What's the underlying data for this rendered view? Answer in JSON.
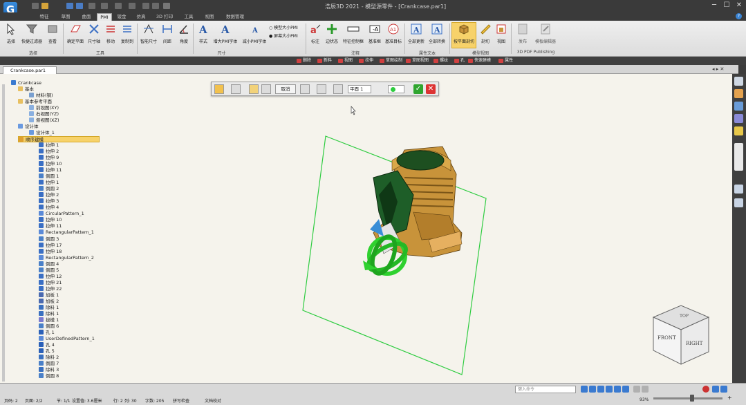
{
  "window": {
    "title": "浩辰3D 2021 - 模型源零件 - [Crankcase.par1]",
    "logo": "G",
    "controls": [
      "─",
      "☐",
      "✕"
    ]
  },
  "tabs": [
    {
      "label": "特征",
      "active": false
    },
    {
      "label": "草图",
      "active": false
    },
    {
      "label": "曲面",
      "active": false
    },
    {
      "label": "PMI",
      "active": true
    },
    {
      "label": "钣金",
      "active": false
    },
    {
      "label": "仿真",
      "active": false
    },
    {
      "label": "3D 打印",
      "active": false
    },
    {
      "label": "工具",
      "active": false
    },
    {
      "label": "视图",
      "active": false
    },
    {
      "label": "数据管理",
      "active": false
    }
  ],
  "ribbon": {
    "buttons": [
      {
        "label": "选择",
        "icon": "cursor-icon"
      },
      {
        "label": "快捷过滤器",
        "icon": "filter-icon"
      },
      {
        "label": "查看",
        "icon": "view-icon"
      },
      {
        "label": "确定平面",
        "icon": "plane-icon"
      },
      {
        "label": "尺寸轴",
        "icon": "axis-icon"
      },
      {
        "label": "移动",
        "icon": "move-icon"
      },
      {
        "label": "复制到",
        "icon": "copy-icon"
      },
      {
        "label": "智能尺寸",
        "icon": "smart-dimension-icon"
      },
      {
        "label": "间距",
        "icon": "distance-icon"
      },
      {
        "label": "角度",
        "icon": "angle-icon"
      },
      {
        "label": "样式",
        "icon": "style-icon"
      },
      {
        "label": "增大PMI字体",
        "icon": "font-increase-icon"
      },
      {
        "label": "减小PMI字体",
        "icon": "font-decrease-icon"
      },
      {
        "label": "标注",
        "icon": "annotation-icon"
      },
      {
        "label": "边状态",
        "icon": "edge-state-icon"
      },
      {
        "label": "特征控制框",
        "icon": "feature-control-frame-icon"
      },
      {
        "label": "基准框",
        "icon": "datum-frame-icon"
      },
      {
        "label": "基准目标",
        "icon": "datum-target-icon"
      },
      {
        "label": "全部更新",
        "icon": "update-all-icon"
      },
      {
        "label": "全部转换",
        "icon": "convert-all-icon"
      },
      {
        "label": "按平面剖切",
        "icon": "section-plane-icon"
      },
      {
        "label": "剖切",
        "icon": "section-icon"
      },
      {
        "label": "视图",
        "icon": "model-view-icon"
      },
      {
        "label": "发布",
        "icon": "publish-icon"
      },
      {
        "label": "模板编辑器",
        "icon": "template-editor-icon"
      }
    ],
    "toggles": [
      {
        "label": "模型大小PMI"
      },
      {
        "label": "屏幕大小PMI"
      }
    ],
    "groups": [
      "选择",
      "工具",
      "尺寸",
      "注释",
      "属性文本",
      "模型视图",
      "3D PDF Publishing"
    ]
  },
  "command_bar": [
    {
      "label": "删除"
    },
    {
      "label": "新料"
    },
    {
      "label": "视图"
    },
    {
      "label": "拉伸"
    },
    {
      "label": "草图绘制"
    },
    {
      "label": "草图视图"
    },
    {
      "label": "螺纹"
    },
    {
      "label": "孔"
    },
    {
      "label": "快速建模"
    },
    {
      "label": "属性"
    }
  ],
  "document_tab": {
    "label": "Crankcase.par1"
  },
  "floating_toolbar": {
    "cancel_label": "取消",
    "plane_value": "平面 1"
  },
  "tree": [
    {
      "label": "Crankcase",
      "indent": 0,
      "icon": "part-icon"
    },
    {
      "label": "基本",
      "indent": 1,
      "icon": "folder-icon"
    },
    {
      "label": "材料(钢)",
      "indent": 2,
      "icon": "material-icon"
    },
    {
      "label": "基本参考平面",
      "indent": 1,
      "icon": "folder-icon"
    },
    {
      "label": "前视图(XY)",
      "indent": 2,
      "icon": "plane-icon"
    },
    {
      "label": "右视图(YZ)",
      "indent": 2,
      "icon": "plane-icon"
    },
    {
      "label": "俯视图(XZ)",
      "indent": 2,
      "icon": "plane-icon"
    },
    {
      "label": "设计体",
      "indent": 1,
      "icon": "body-icon"
    },
    {
      "label": "设计体_1",
      "indent": 2,
      "icon": "body-icon"
    },
    {
      "label": "顺序建模",
      "indent": 1,
      "icon": "sequence-icon",
      "selected": true
    },
    {
      "label": "拉伸 1",
      "indent": 3,
      "icon": "extrude-icon"
    },
    {
      "label": "拉伸 2",
      "indent": 3,
      "icon": "extrude-icon"
    },
    {
      "label": "拉伸 9",
      "indent": 3,
      "icon": "extrude-icon"
    },
    {
      "label": "拉伸 10",
      "indent": 3,
      "icon": "extrude-icon"
    },
    {
      "label": "拉伸 11",
      "indent": 3,
      "icon": "extrude-icon"
    },
    {
      "label": "倒圆 1",
      "indent": 3,
      "icon": "round-icon"
    },
    {
      "label": "拉伸 1",
      "indent": 3,
      "icon": "extrude-icon"
    },
    {
      "label": "倒圆 2",
      "indent": 3,
      "icon": "round-icon"
    },
    {
      "label": "拉伸 2",
      "indent": 3,
      "icon": "extrude-icon"
    },
    {
      "label": "拉伸 3",
      "indent": 3,
      "icon": "extrude-icon"
    },
    {
      "label": "拉伸 4",
      "indent": 3,
      "icon": "extrude-icon"
    },
    {
      "label": "CircularPattern_1",
      "indent": 3,
      "icon": "pattern-icon"
    },
    {
      "label": "拉伸 10",
      "indent": 3,
      "icon": "extrude-icon"
    },
    {
      "label": "拉伸 11",
      "indent": 3,
      "icon": "extrude-icon"
    },
    {
      "label": "RectangularPattern_1",
      "indent": 3,
      "icon": "pattern-icon"
    },
    {
      "label": "倒圆 3",
      "indent": 3,
      "icon": "round-icon"
    },
    {
      "label": "拉伸 17",
      "indent": 3,
      "icon": "extrude-icon"
    },
    {
      "label": "拉伸 18",
      "indent": 3,
      "icon": "extrude-icon"
    },
    {
      "label": "RectangularPattern_2",
      "indent": 3,
      "icon": "pattern-icon"
    },
    {
      "label": "倒圆 4",
      "indent": 3,
      "icon": "round-icon"
    },
    {
      "label": "倒圆 5",
      "indent": 3,
      "icon": "round-icon"
    },
    {
      "label": "拉伸 12",
      "indent": 3,
      "icon": "extrude-icon"
    },
    {
      "label": "拉伸 21",
      "indent": 3,
      "icon": "extrude-icon"
    },
    {
      "label": "拉伸 22",
      "indent": 3,
      "icon": "extrude-icon"
    },
    {
      "label": "加板 1",
      "indent": 3,
      "icon": "rib-icon"
    },
    {
      "label": "加板 2",
      "indent": 3,
      "icon": "rib-icon"
    },
    {
      "label": "除料 1",
      "indent": 3,
      "icon": "cut-icon"
    },
    {
      "label": "除料 1",
      "indent": 3,
      "icon": "cut-icon"
    },
    {
      "label": "拔模 1",
      "indent": 3,
      "icon": "draft-icon"
    },
    {
      "label": "倒圆 6",
      "indent": 3,
      "icon": "round-icon"
    },
    {
      "label": "孔 1",
      "indent": 3,
      "icon": "hole-icon"
    },
    {
      "label": "UserDefinedPattern_1",
      "indent": 3,
      "icon": "pattern-icon"
    },
    {
      "label": "孔 4",
      "indent": 3,
      "icon": "hole-icon"
    },
    {
      "label": "孔 5",
      "indent": 3,
      "icon": "hole-icon"
    },
    {
      "label": "除料 2",
      "indent": 3,
      "icon": "cut-icon"
    },
    {
      "label": "倒圆 7",
      "indent": 3,
      "icon": "round-icon"
    },
    {
      "label": "除料 3",
      "indent": 3,
      "icon": "cut-icon"
    },
    {
      "label": "倒圆 8",
      "indent": 3,
      "icon": "round-icon"
    }
  ],
  "view_cube": {
    "top": "TOP",
    "front": "FRONT",
    "right": "RIGHT"
  },
  "status_bar": {
    "command_placeholder": "键入命令",
    "items": [
      "页码: 2",
      "页面: 2/2",
      "节: 1/1",
      "设置值: 3.6厘米",
      "行: 2",
      "列: 30",
      "字数: 205",
      "拼写检查",
      "文档校对"
    ],
    "zoom": "93%"
  },
  "colors": {
    "accent": "#2f80d6",
    "plane_outline": "#2ecc40",
    "model_bronze": "#c8933a",
    "model_green": "#1e5e28",
    "selection": "#f7d26a"
  }
}
